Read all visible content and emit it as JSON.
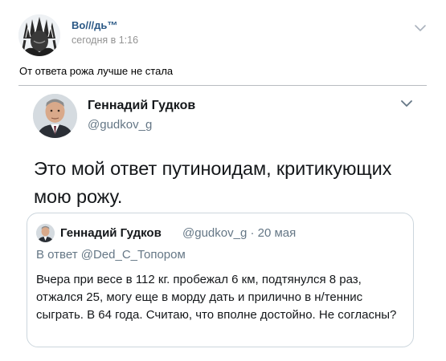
{
  "post": {
    "author": "Во///дь™",
    "date": "сегодня в 1:16",
    "text": "От ответа рожа лучше не стала",
    "menu_icon": "chevron-down-icon"
  },
  "tweet": {
    "author_name": "Геннадий Гудков",
    "handle": "@gudkov_g",
    "text": "Это мой ответ путиноидам, критикующих мою рожу.",
    "caret_icon": "chevron-down-icon",
    "quoted": {
      "author_name": "Геннадий Гудков",
      "handle_and_date": "@gudkov_g · 20 мая",
      "reply_to": "В ответ @Ded_C_Топором",
      "text": "Вчера при весе в 112 кг. пробежал 6 км, подтянулся 8 раз, отжался 25, могу еще в морду дать и прилично в н/теннис сыграть. В 64 года. Считаю, что вполне достойно. Не согласны?"
    }
  },
  "colors": {
    "vk_link": "#2a5885",
    "vk_meta": "#939393",
    "tw_text": "#14171a",
    "tw_secondary": "#657786",
    "tw_border": "#ccd6dd"
  }
}
